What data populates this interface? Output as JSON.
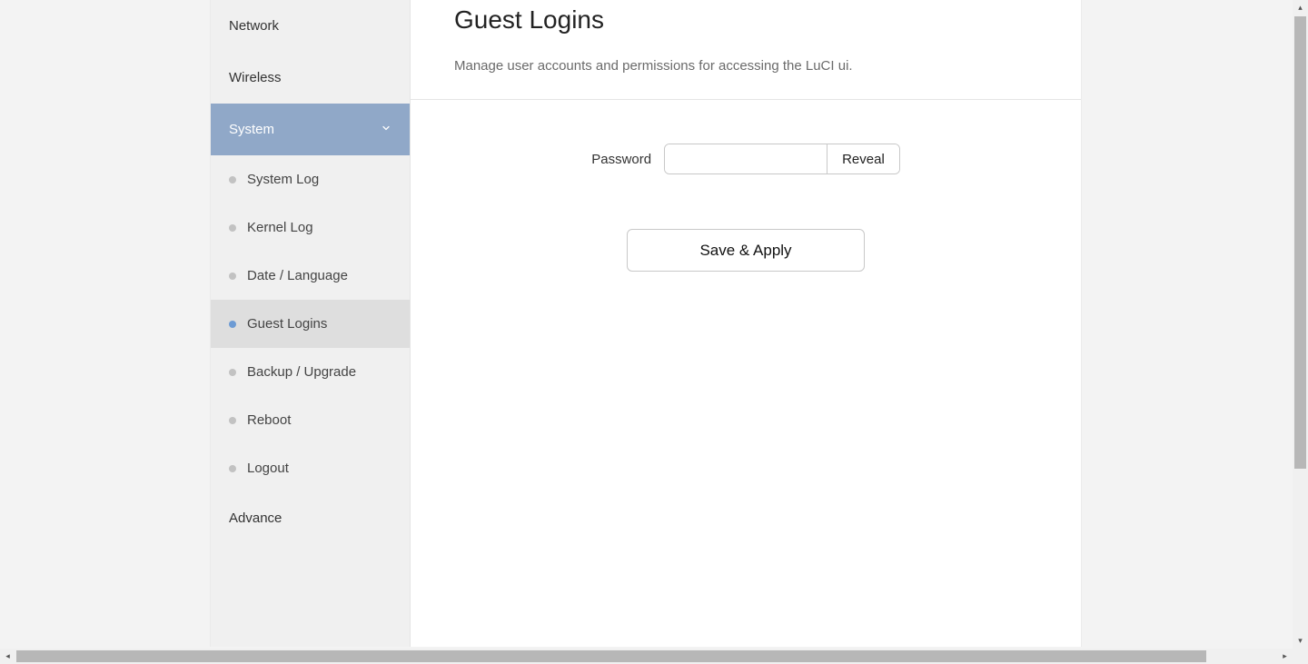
{
  "sidebar": {
    "items": [
      {
        "label": "Network"
      },
      {
        "label": "Wireless"
      },
      {
        "label": "System",
        "expanded": true,
        "submenu": [
          {
            "label": "System Log"
          },
          {
            "label": "Kernel Log"
          },
          {
            "label": "Date / Language"
          },
          {
            "label": "Guest Logins",
            "selected": true
          },
          {
            "label": "Backup / Upgrade"
          },
          {
            "label": "Reboot"
          },
          {
            "label": "Logout"
          }
        ]
      },
      {
        "label": "Advance"
      }
    ]
  },
  "page": {
    "title": "Guest Logins",
    "description": "Manage user accounts and permissions for accessing the LuCI ui."
  },
  "form": {
    "password_label": "Password",
    "password_value": "",
    "reveal_label": "Reveal",
    "apply_label": "Save & Apply"
  }
}
